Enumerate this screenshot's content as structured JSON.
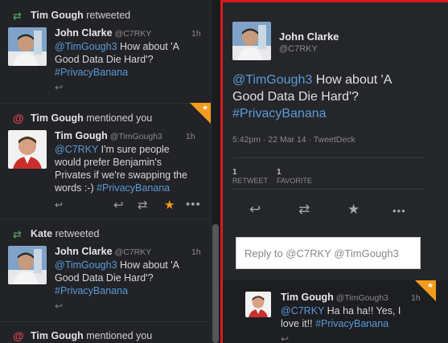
{
  "left_column": {
    "items": [
      {
        "context_user": "Tim Gough",
        "context_action": "retweeted",
        "context_icon": "retweet-icon",
        "author": "John Clarke",
        "handle": "@C7RKY",
        "time": "1h",
        "mention": "@TimGough3",
        "text": " How about 'A Good Data Die Hard'?",
        "hashtag": "#PrivacyBanana"
      },
      {
        "context_user": "Tim Gough",
        "context_action": "mentioned you",
        "context_icon": "mention-icon",
        "author": "Tim Gough",
        "handle": "@TimGough3",
        "time": "1h",
        "mention": "@C7RKY",
        "text": " I'm sure people would prefer Benjamin's Privates if we're swapping the words :-) ",
        "hashtag": "#PrivacyBanana",
        "favorited": true
      },
      {
        "context_user": "Kate",
        "context_action": "retweeted",
        "context_icon": "retweet-icon",
        "author": "John Clarke",
        "handle": "@C7RKY",
        "time": "1h",
        "mention": "@TimGough3",
        "text": " How about 'A Good Data Die Hard'?",
        "hashtag": "#PrivacyBanana"
      },
      {
        "context_user": "Tim Gough",
        "context_action": "mentioned you",
        "context_icon": "mention-icon"
      }
    ]
  },
  "detail": {
    "author": "John Clarke",
    "handle": "@C7RKY",
    "mention": "@TimGough3",
    "text": " How about 'A Good Data Die Hard'?",
    "hashtag": "#PrivacyBanana",
    "meta": "5:42pm · 22 Mar 14 · TweetDeck",
    "retweets_count": "1",
    "retweets_label": "RETWEET",
    "favorites_count": "1",
    "favorites_label": "FAVORITE",
    "reply_placeholder": "Reply to @C7RKY @TimGough3",
    "reply_tweet": {
      "author": "Tim Gough",
      "handle": "@TimGough3",
      "time": "1h",
      "mention": "@C7RKY",
      "text": " Ha ha ha!!  Yes, I love it!! ",
      "hashtag": "#PrivacyBanana"
    }
  },
  "colors": {
    "link": "#5b9ad8",
    "retweet_green": "#5bb36a",
    "mention_red": "#d94452",
    "favorite_orange": "#f39b1c",
    "selection_red": "#d81a1f"
  }
}
